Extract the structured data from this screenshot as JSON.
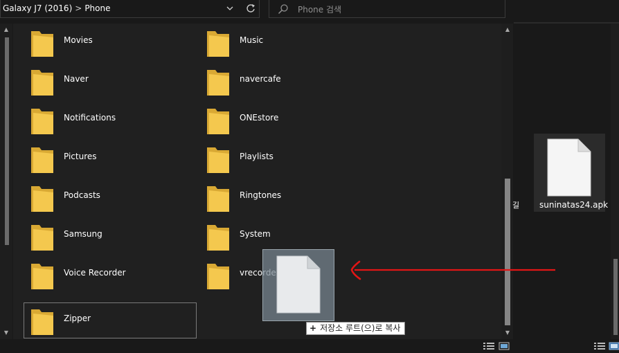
{
  "address_bar": {
    "segments": [
      "Galaxy J7 (2016)",
      "Phone"
    ],
    "separator": ">",
    "dropdown_icon": "chevron-down-icon",
    "refresh_icon": "refresh-icon"
  },
  "search": {
    "placeholder": "Phone 검색",
    "icon": "search-icon"
  },
  "folders": [
    {
      "name": "Movies"
    },
    {
      "name": "Music"
    },
    {
      "name": "Naver"
    },
    {
      "name": "navercafe"
    },
    {
      "name": "Notifications"
    },
    {
      "name": "ONEstore"
    },
    {
      "name": "Pictures"
    },
    {
      "name": "Playlists"
    },
    {
      "name": "Podcasts"
    },
    {
      "name": "Ringtones"
    },
    {
      "name": "Samsung"
    },
    {
      "name": "System"
    },
    {
      "name": "Voice Recorder"
    },
    {
      "name": "vrecorder"
    },
    {
      "name": "Zipper"
    }
  ],
  "drag": {
    "tooltip": "저장소 루트(으)로 복사",
    "tooltip_icon": "plus-icon"
  },
  "source_window": {
    "file_name": "suninatas24.apk",
    "cut_off_text": "길"
  },
  "colors": {
    "folder_yellow": "#f4c84e",
    "annotation_red": "#e31515"
  }
}
